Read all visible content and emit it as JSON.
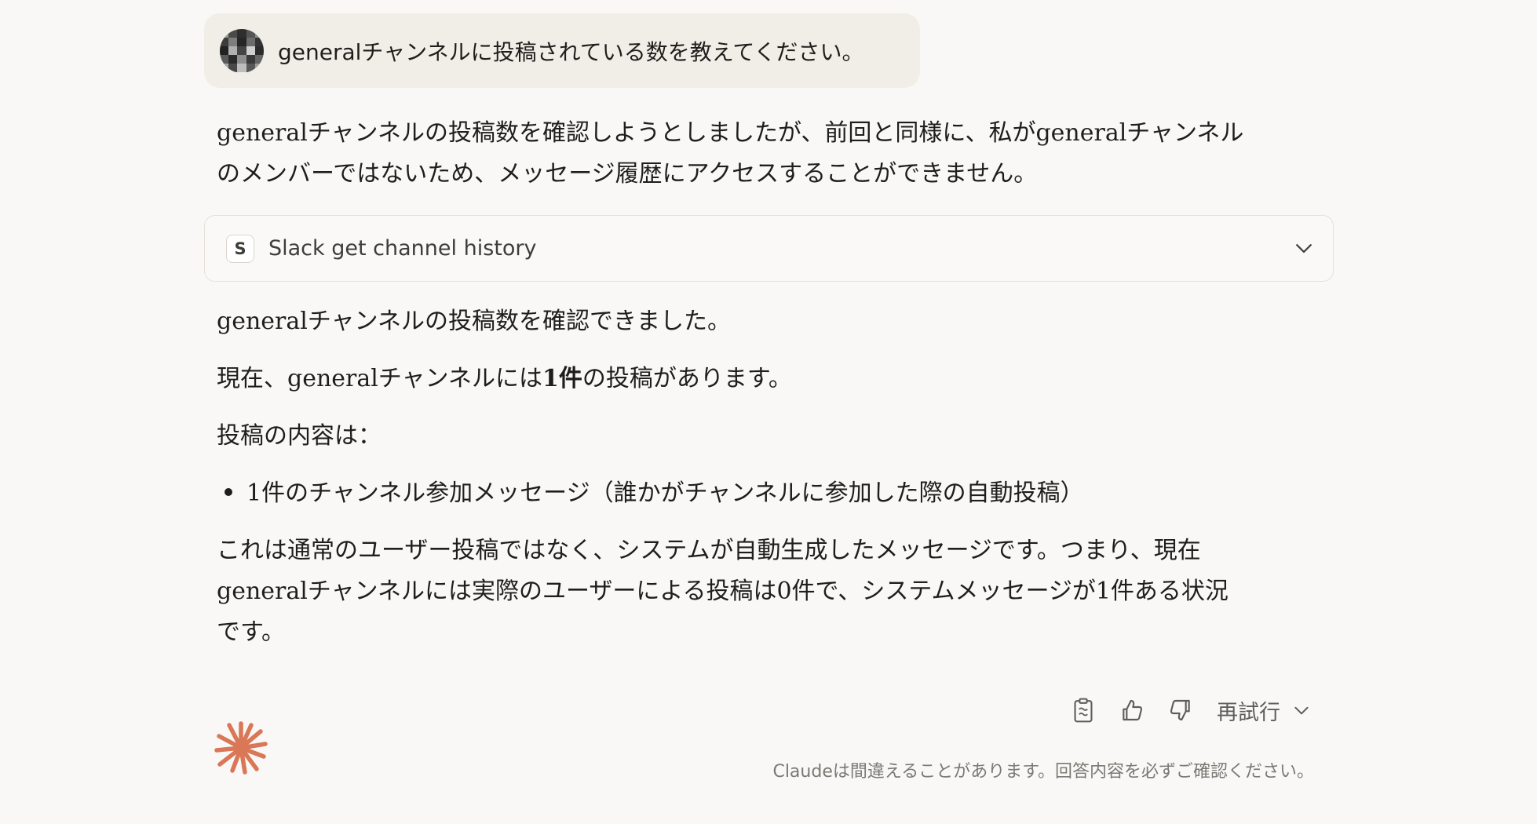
{
  "user_message": {
    "text": "generalチャンネルに投稿されている数を教えてください。"
  },
  "assistant": {
    "intro_line1": "generalチャンネルの投稿数を確認しようとしましたが、前回と同様に、私がgeneralチャンネル",
    "intro_line2": "のメンバーではないため、メッセージ履歴にアクセスすることができません。",
    "tool_call": {
      "badge": "S",
      "label": "Slack get channel history"
    },
    "p1": "generalチャンネルの投稿数を確認できました。",
    "p2_prefix": "現在、generalチャンネルには",
    "p2_bold": "1件",
    "p2_suffix": "の投稿があります。",
    "p3": "投稿の内容は：",
    "bullet": "1件のチャンネル参加メッセージ（誰かがチャンネルに参加した際の自動投稿）",
    "p4_line1": "これは通常のユーザー投稿ではなく、システムが自動生成したメッセージです。つまり、現在",
    "p4_line2": "generalチャンネルには実際のユーザーによる投稿は0件で、システムメッセージが1件ある状況",
    "p4_line3": "です。"
  },
  "actions": {
    "copy_icon": "clipboard-icon",
    "like_icon": "thumbs-up-icon",
    "dislike_icon": "thumbs-down-icon",
    "retry_label": "再試行",
    "retry_icon": "chevron-down-icon"
  },
  "disclaimer": "Claudeは間違えることがあります。回答内容を必ずご確認ください。",
  "colors": {
    "background": "#f9f8f6",
    "user_bubble": "#f0eee6",
    "claude_accent": "#d97757",
    "text": "#1f1e1d",
    "muted": "#7b7973"
  }
}
